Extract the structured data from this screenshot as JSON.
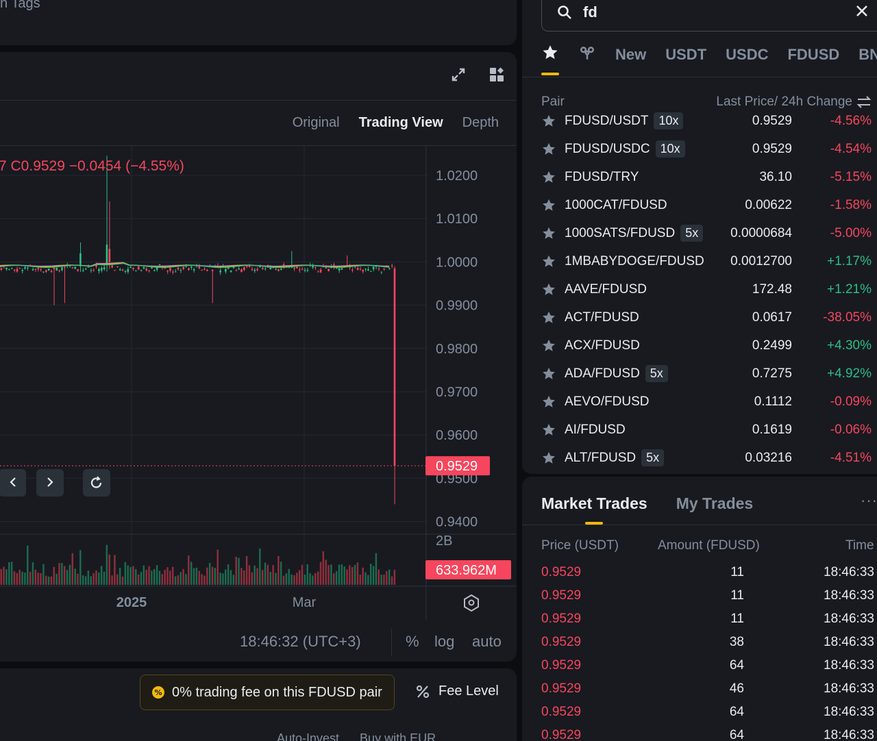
{
  "top_strip": {
    "tags_text": "n Tags"
  },
  "chart": {
    "tabs": [
      {
        "label": "Original",
        "active": false
      },
      {
        "label": "Trading View",
        "active": true
      },
      {
        "label": "Depth",
        "active": false
      }
    ],
    "ohlc_text": "7  C0.9529  −0.0454 (−4.55%)",
    "price_ticks": [
      "1.0200",
      "1.0100",
      "1.0000",
      "0.9900",
      "0.9800",
      "0.9700",
      "0.9600",
      "0.9500",
      "0.9400"
    ],
    "current_price_label": "0.9529",
    "volume_axis_label": "2B",
    "volume_label": "633.962M",
    "x_labels": [
      "2025",
      "Mar"
    ],
    "time_text": "18:46:32 (UTC+3)",
    "scale_options": [
      "%",
      "log",
      "auto"
    ],
    "colors": {
      "down": "#f6465d",
      "up": "#2ebd85",
      "accent": "#f0b90b"
    }
  },
  "fee": {
    "badge_text": "0% trading fee on this FDUSD pair",
    "fee_level_label": "Fee Level",
    "bottom_links": [
      "Auto-Invest",
      "Buy with EUR"
    ]
  },
  "search": {
    "value": "fd"
  },
  "category_tabs": [
    "New",
    "USDT",
    "USDC",
    "FDUSD",
    "BN"
  ],
  "pairs_header": {
    "pair": "Pair",
    "price_change": "Last Price/ 24h Change"
  },
  "pairs": [
    {
      "symbol": "FDUSD/USDT",
      "leverage": "10x",
      "price": "0.9529",
      "change": "-4.56%",
      "dir": "neg"
    },
    {
      "symbol": "FDUSD/USDC",
      "leverage": "10x",
      "price": "0.9529",
      "change": "-4.54%",
      "dir": "neg"
    },
    {
      "symbol": "FDUSD/TRY",
      "leverage": "",
      "price": "36.10",
      "change": "-5.15%",
      "dir": "neg"
    },
    {
      "symbol": "1000CAT/FDUSD",
      "leverage": "",
      "price": "0.00622",
      "change": "-1.58%",
      "dir": "neg"
    },
    {
      "symbol": "1000SATS/FDUSD",
      "leverage": "5x",
      "price": "0.0000684",
      "change": "-5.00%",
      "dir": "neg"
    },
    {
      "symbol": "1MBABYDOGE/FDUSD",
      "leverage": "",
      "price": "0.0012700",
      "change": "+1.17%",
      "dir": "pos"
    },
    {
      "symbol": "AAVE/FDUSD",
      "leverage": "",
      "price": "172.48",
      "change": "+1.21%",
      "dir": "pos"
    },
    {
      "symbol": "ACT/FDUSD",
      "leverage": "",
      "price": "0.0617",
      "change": "-38.05%",
      "dir": "neg"
    },
    {
      "symbol": "ACX/FDUSD",
      "leverage": "",
      "price": "0.2499",
      "change": "+4.30%",
      "dir": "pos"
    },
    {
      "symbol": "ADA/FDUSD",
      "leverage": "5x",
      "price": "0.7275",
      "change": "+4.92%",
      "dir": "pos"
    },
    {
      "symbol": "AEVO/FDUSD",
      "leverage": "",
      "price": "0.1112",
      "change": "-0.09%",
      "dir": "neg"
    },
    {
      "symbol": "AI/FDUSD",
      "leverage": "",
      "price": "0.1619",
      "change": "-0.06%",
      "dir": "neg"
    },
    {
      "symbol": "ALT/FDUSD",
      "leverage": "5x",
      "price": "0.03216",
      "change": "-4.51%",
      "dir": "neg"
    }
  ],
  "trades": {
    "tabs": [
      {
        "label": "Market Trades",
        "active": true
      },
      {
        "label": "My Trades",
        "active": false
      }
    ],
    "more": "···",
    "header": {
      "price": "Price (USDT)",
      "amount": "Amount (FDUSD)",
      "time": "Time"
    },
    "rows": [
      {
        "price": "0.9529",
        "amount": "11",
        "time": "18:46:33"
      },
      {
        "price": "0.9529",
        "amount": "11",
        "time": "18:46:33"
      },
      {
        "price": "0.9529",
        "amount": "11",
        "time": "18:46:33"
      },
      {
        "price": "0.9529",
        "amount": "38",
        "time": "18:46:33"
      },
      {
        "price": "0.9529",
        "amount": "64",
        "time": "18:46:33"
      },
      {
        "price": "0.9529",
        "amount": "46",
        "time": "18:46:33"
      },
      {
        "price": "0.9529",
        "amount": "64",
        "time": "18:46:33"
      },
      {
        "price": "0.9529",
        "amount": "64",
        "time": "18:46:33"
      }
    ]
  }
}
